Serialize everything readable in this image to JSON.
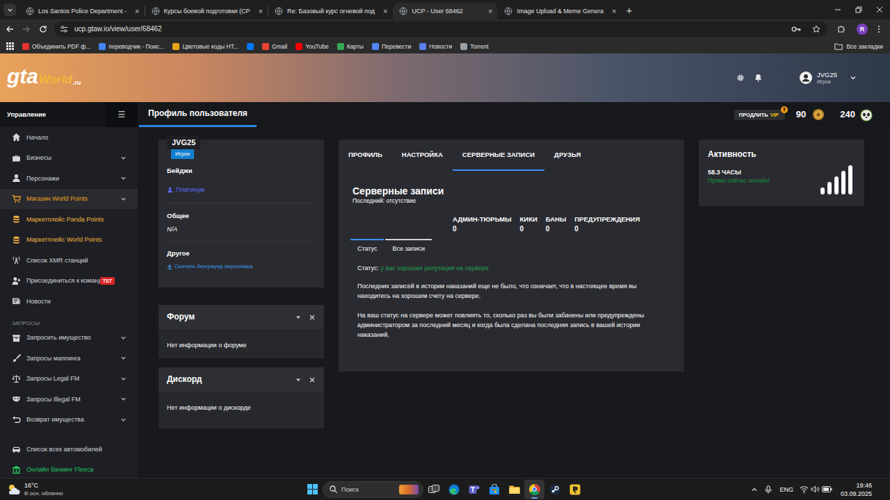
{
  "browser": {
    "tabs": [
      {
        "label": "Los Santos Police Department -",
        "selected": false
      },
      {
        "label": "Курсы боевой подготовки (СР",
        "selected": false
      },
      {
        "label": "Re: Базовый курс огневой под",
        "selected": false
      },
      {
        "label": "UCP - User 68462",
        "selected": true
      },
      {
        "label": "Image Upload & Meme Genera",
        "selected": false
      }
    ],
    "close_glyph": "×",
    "new_tab": "+",
    "url": "ucp.gtaw.io/view/user/68462",
    "forward_enabled": false,
    "profile_initial": "R",
    "bookmarks": [
      {
        "label": "Объединить PDF ф...",
        "color": "#e5322d"
      },
      {
        "label": "переводчик - Поис...",
        "color": "#4285f4"
      },
      {
        "label": "Цветовые коды HT...",
        "color": "#e8a317"
      },
      {
        "color": "#0077ff"
      },
      {
        "label": "Gmail",
        "color": "#ea4335"
      },
      {
        "label": "YouTube",
        "color": "#ff0000"
      },
      {
        "label": "Карты",
        "color": "#34a853"
      },
      {
        "label": "Перевести",
        "color": "#4f86f7"
      },
      {
        "label": "Новости",
        "color": "#5b7ff0"
      },
      {
        "label": "Torrent",
        "color": "#9aa0a6"
      }
    ],
    "all_bookmarks": "Все закладки"
  },
  "site": {
    "logo": {
      "main": "gta",
      "script": "World",
      "suffix": ".ru"
    },
    "account": {
      "name": "JVG25",
      "role": "Игрок"
    },
    "sidebar": {
      "title": "Управление",
      "menu_glyph": "☰",
      "groups": [
        {
          "items": [
            {
              "label": "Начало",
              "expandable": false,
              "selected": false,
              "color": "#d4d6db"
            },
            {
              "label": "Бизнесы",
              "expandable": true,
              "selected": false,
              "color": "#d4d6db"
            },
            {
              "label": "Персонажи",
              "expandable": true,
              "selected": false,
              "color": "#d4d6db"
            },
            {
              "label": "Магазин World Points",
              "expandable": true,
              "selected": true,
              "color": "#f0a020"
            },
            {
              "label": "Маркетплейс Panda Points",
              "expandable": false,
              "selected": false,
              "color": "#f5b342"
            },
            {
              "label": "Маркетплейс World Points",
              "expandable": false,
              "selected": false,
              "color": "#f5b342"
            },
            {
              "label": "Список XMR станций",
              "expandable": false,
              "selected": false,
              "color": "#d4d6db"
            },
            {
              "label": "Присоединиться к команде!",
              "expandable": false,
              "selected": false,
              "color": "#d4d6db",
              "badge": "TST"
            },
            {
              "label": "Новости",
              "expandable": false,
              "selected": false,
              "color": "#d4d6db"
            }
          ]
        },
        {
          "title": "ЗАПРОСЫ",
          "items": [
            {
              "label": "Запросить имущество",
              "expandable": true,
              "selected": false,
              "color": "#d4d6db"
            },
            {
              "label": "Запросы маппинга",
              "expandable": true,
              "selected": false,
              "color": "#d4d6db"
            },
            {
              "label": "Запросы Legal FM",
              "expandable": true,
              "selected": false,
              "color": "#d4d6db"
            },
            {
              "label": "Запросы Illegal FM",
              "expandable": true,
              "selected": false,
              "color": "#d4d6db"
            },
            {
              "label": "Возврат имущества",
              "expandable": true,
              "selected": false,
              "color": "#d4d6db"
            }
          ]
        },
        {
          "items": [
            {
              "label": "Список всех автомобилей",
              "expandable": false,
              "selected": false,
              "color": "#d4d6db"
            },
            {
              "label": "Онлайн банкинг Fleeca",
              "expandable": false,
              "selected": false,
              "color": "#22c55e"
            }
          ]
        }
      ]
    },
    "page_title": "Профиль пользователя",
    "vip": {
      "prefix": "ПРОДЛИТЬ",
      "label": "VIP",
      "count": "5"
    },
    "world_points": "90",
    "panda_points": "240",
    "profile_card": {
      "name": "JVG25",
      "role": "Игрок",
      "sections": [
        {
          "title": "Бейджи",
          "value": "Платинум",
          "kind": "badge"
        },
        {
          "title": "Общее",
          "value": "N/A",
          "kind": "text"
        },
        {
          "title": "Другое",
          "value": "Скачать бекграунд персонажа",
          "kind": "link"
        }
      ]
    },
    "widgets": [
      {
        "title": "Форум",
        "body": "Нет информации о форуме"
      },
      {
        "title": "Дискорд",
        "body": "Нет информации о дискорде"
      }
    ],
    "records": {
      "tabs": [
        {
          "label": "ПРОФИЛЬ",
          "selected": false
        },
        {
          "label": "НАСТРОЙКА",
          "selected": false
        },
        {
          "label": "СЕРВЕРНЫЕ ЗАПИСИ",
          "selected": true
        },
        {
          "label": "ДРУЗЬЯ",
          "selected": false
        }
      ],
      "title": "Серверные записи",
      "last": "Последний: отсутствие",
      "stats": [
        {
          "label": "АДМИН-ТЮРЬМЫ",
          "value": "0"
        },
        {
          "label": "КИКИ",
          "value": "0"
        },
        {
          "label": "БАНЫ",
          "value": "0"
        },
        {
          "label": "ПРЕДУПРЕЖДЕНИЯ",
          "value": "0"
        }
      ],
      "subtabs": [
        {
          "label": "Статус",
          "selected": true
        },
        {
          "label": "Все записи",
          "selected": false
        }
      ],
      "status_label": "Статус:",
      "status_value": "у вас хорошая репутация на сервере",
      "paragraphs": [
        "Последних записей в истории наказаний еще не было, что означает, что в настоящее время вы находитесь на хорошем счету на сервере.",
        "На ваш статус на сервере может повлиять то, сколько раз вы были забанены или предупреждены администратором за последний месяц и когда была сделана последняя запись в вашей истории наказаний."
      ]
    },
    "activity": {
      "title": "Активность",
      "hours": "58.3 ЧАСЫ",
      "online": "Прямо сейчас онлайн!"
    }
  },
  "taskbar": {
    "weather": {
      "temp": "16°C",
      "desc": "В осн. облачно"
    },
    "search": "Поиск",
    "apps": [
      {
        "kind": "taskview",
        "selected": false
      },
      {
        "kind": "edge",
        "selected": false
      },
      {
        "kind": "teams",
        "selected": false
      },
      {
        "kind": "store",
        "selected": false
      },
      {
        "kind": "explorer",
        "selected": false
      },
      {
        "kind": "chrome",
        "selected": true
      },
      {
        "kind": "steam",
        "selected": false
      },
      {
        "kind": "app",
        "selected": false
      }
    ],
    "lang": "ENG",
    "time": "19:46",
    "date": "03.09.2025"
  }
}
